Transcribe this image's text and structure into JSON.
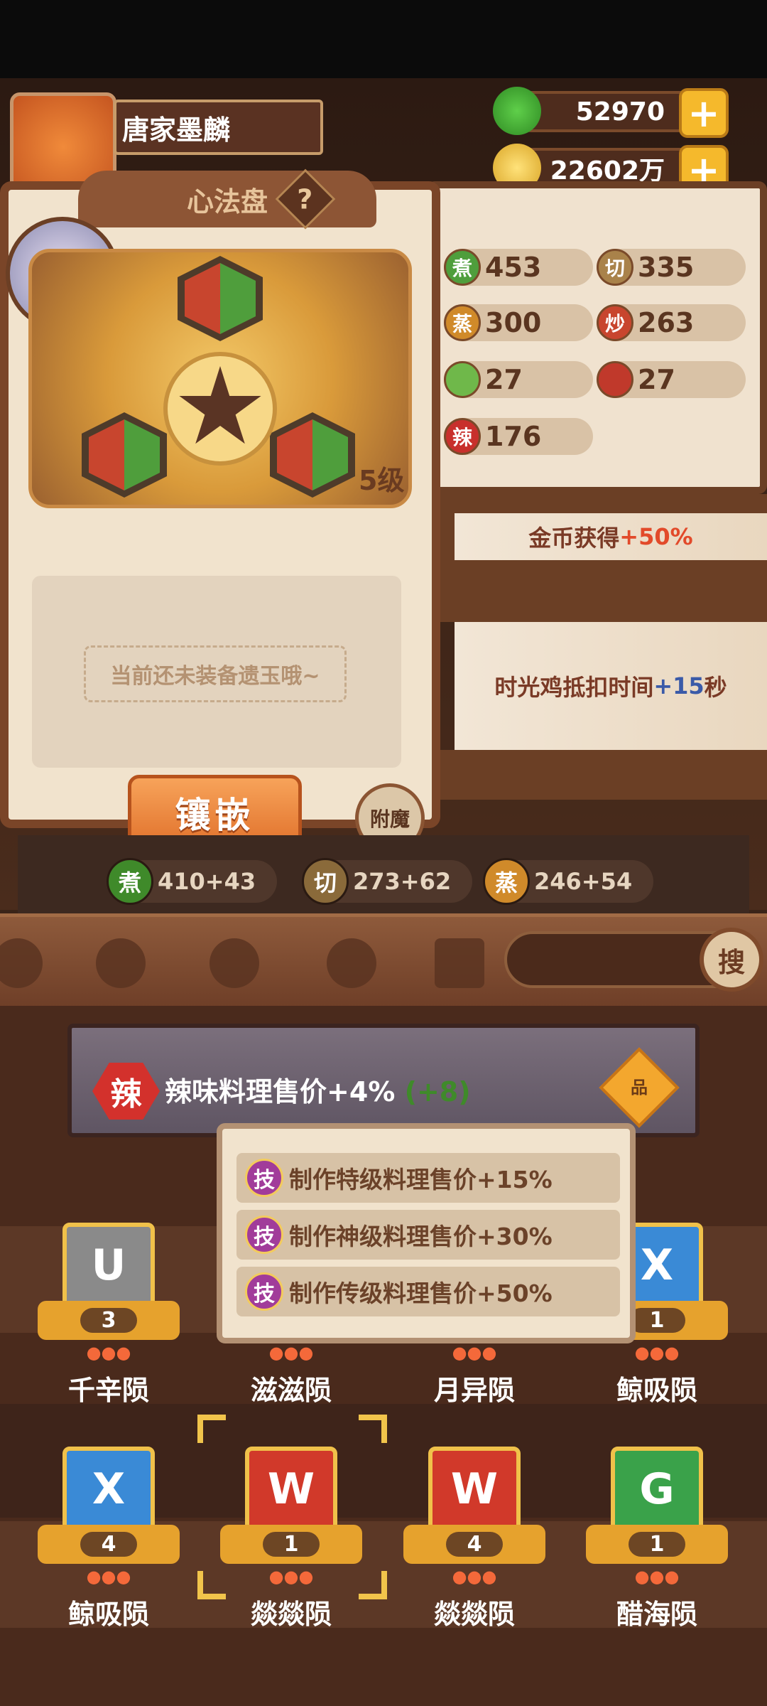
{
  "player": {
    "name": "唐家墨麟"
  },
  "currency": {
    "jade": "52970",
    "coins": "22602万"
  },
  "panel": {
    "title": "心法盘",
    "help": "?",
    "level": "5级",
    "empty_hint": "当前还未装备遗玉哦~",
    "inlay_button": "镶嵌",
    "enchant_button": "附魔"
  },
  "stats": [
    {
      "icon": "煮",
      "value": "453",
      "color": "#4f9e3c"
    },
    {
      "icon": "切",
      "value": "335",
      "color": "#a9824a"
    },
    {
      "icon": "蒸",
      "value": "300",
      "color": "#d08a2a"
    },
    {
      "icon": "炒",
      "value": "263",
      "color": "#c8452e"
    },
    {
      "icon": "",
      "value": "27",
      "color": "#6fb84a"
    },
    {
      "icon": "",
      "value": "27",
      "color": "#c0392b"
    },
    {
      "icon": "辣",
      "value": "176",
      "color": "#c8302c"
    }
  ],
  "bonus": {
    "coin_prefix": "金币获得",
    "coin_value": "+50%",
    "chicken_prefix": "时光鸡抵扣时间",
    "chicken_value": "+15",
    "chicken_unit": "秒"
  },
  "bottom_stats": [
    {
      "icon": "煮",
      "value": "410+43",
      "color": "#3f8a2a"
    },
    {
      "icon": "切",
      "value": "273+62",
      "color": "#8a6a3a"
    },
    {
      "icon": "蒸",
      "value": "246+54",
      "color": "#d08a2a"
    }
  ],
  "search": {
    "button": "搜"
  },
  "sign": {
    "icon": "辣",
    "text": "辣味料理售价+4%",
    "bonus": "(+8)",
    "pin": "品"
  },
  "popup": [
    {
      "icon": "技",
      "text": "制作特级料理售价+15%"
    },
    {
      "icon": "技",
      "text": "制作神级料理售价+30%"
    },
    {
      "icon": "技",
      "text": "制作传级料理售价+50%"
    }
  ],
  "items_row1": [
    {
      "name": "千辛陨",
      "count": "3",
      "glyph": "U",
      "color": "#8a8a8a"
    },
    {
      "name": "滋滋陨",
      "count": "",
      "glyph": "",
      "color": "#c8452e"
    },
    {
      "name": "月异陨",
      "count": "",
      "glyph": "",
      "color": "#c8452e"
    },
    {
      "name": "鲸吸陨",
      "count": "1",
      "glyph": "X",
      "color": "#3a8ad6"
    }
  ],
  "items_row2": [
    {
      "name": "鲸吸陨",
      "count": "4",
      "glyph": "X",
      "color": "#3a8ad6"
    },
    {
      "name": "燚燚陨",
      "count": "1",
      "glyph": "W",
      "color": "#d1392a"
    },
    {
      "name": "燚燚陨",
      "count": "4",
      "glyph": "W",
      "color": "#d1392a"
    },
    {
      "name": "醋海陨",
      "count": "1",
      "glyph": "G",
      "color": "#3aa24a"
    }
  ]
}
